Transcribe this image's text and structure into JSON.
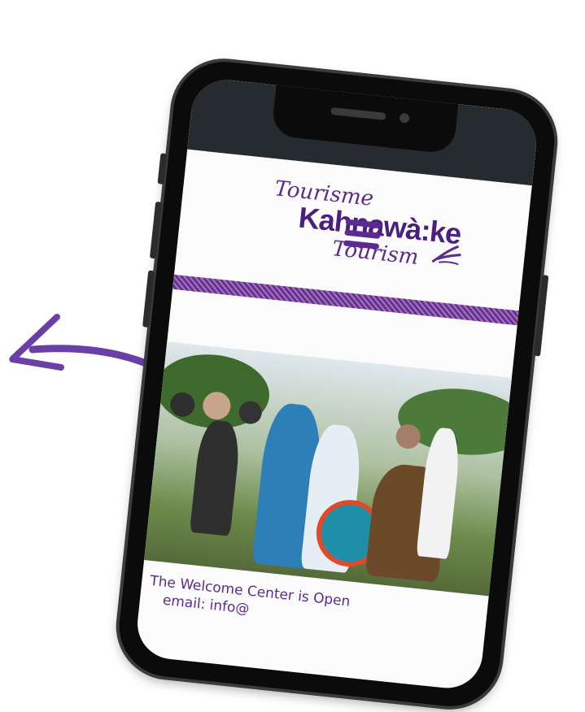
{
  "logo": {
    "line1": "Tourisme",
    "line2": "Kahnawà:ke",
    "line3": "Tourism"
  },
  "nav": {
    "menu_icon": "hamburger-menu-icon"
  },
  "hero": {
    "alt_icon": "powwow-photo"
  },
  "welcome": {
    "line1": "The Welcome Center is Open",
    "line2": "email: info@"
  },
  "colors": {
    "brand_purple": "#5b2b8d",
    "divider_purple": "#6a2f93",
    "status_bar": "#262b30",
    "arrow": "#6b3fa8"
  }
}
